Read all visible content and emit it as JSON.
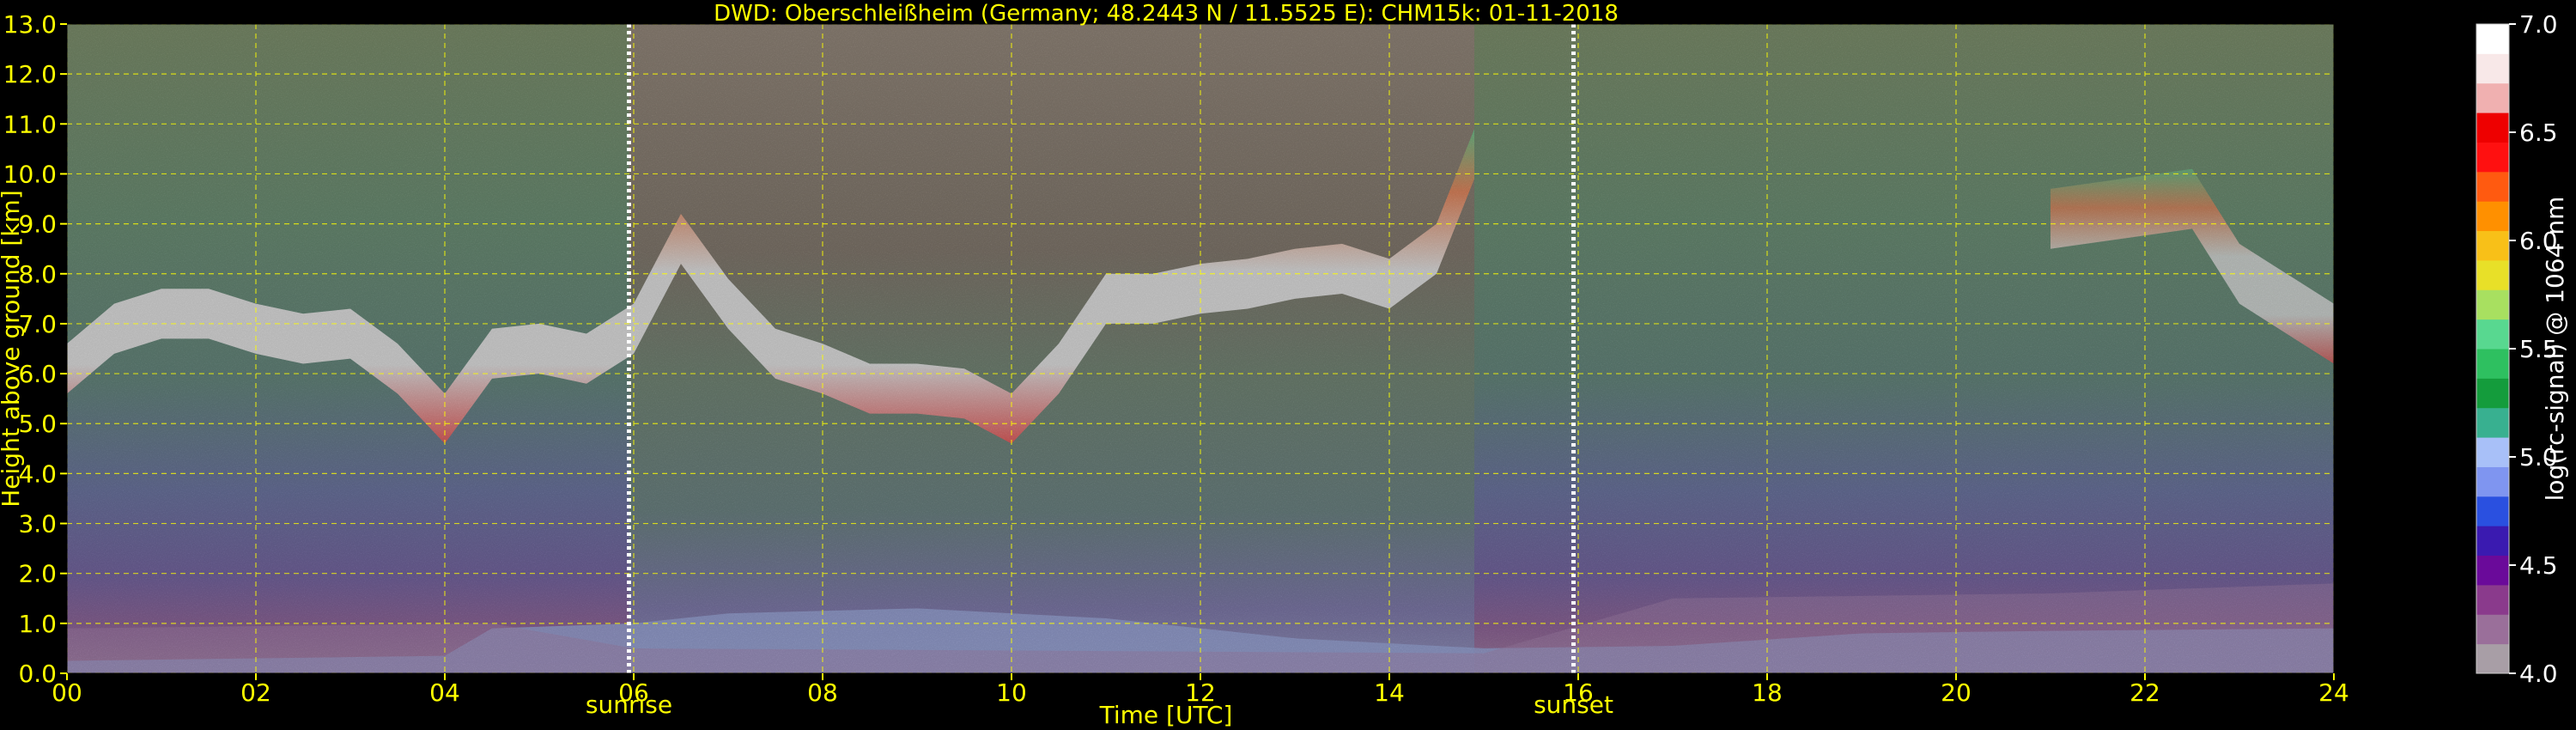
{
  "chart_data": {
    "type": "heatmap",
    "title": "DWD: Oberschleißheim (Germany; 48.2443 N / 11.5525 E):    CHM15k: 01-11-2018",
    "xlabel": "Time [UTC]",
    "ylabel": "Height above ground [km]",
    "colorbar_label": "log(rc-signal) @ 1064 nm",
    "xlim": [
      0,
      24
    ],
    "ylim": [
      0,
      13
    ],
    "x_ticks": [
      "00",
      "02",
      "04",
      "06",
      "08",
      "10",
      "12",
      "14",
      "16",
      "18",
      "20",
      "22",
      "24"
    ],
    "y_ticks": [
      "0.0",
      "1.0",
      "2.0",
      "3.0",
      "4.0",
      "5.0",
      "6.0",
      "7.0",
      "8.0",
      "9.0",
      "10.0",
      "11.0",
      "12.0",
      "13.0"
    ],
    "colorbar_range": [
      4.0,
      7.0
    ],
    "colorbar_ticks": [
      "4.0",
      "4.5",
      "5.0",
      "5.5",
      "6.0",
      "6.5",
      "7.0"
    ],
    "grid": true,
    "grid_color": "#ffff00",
    "markers": [
      {
        "label": "sunrise",
        "time": 5.95
      },
      {
        "label": "sunset",
        "time": 15.95
      }
    ],
    "colorscale": [
      "#a89ea6",
      "#9a6f9a",
      "#8a3a8c",
      "#6a0a9a",
      "#3a1ab0",
      "#2a50e0",
      "#7f95f0",
      "#a8c0f8",
      "#38b090",
      "#149c3c",
      "#2ec060",
      "#58d890",
      "#a8e060",
      "#e8e028",
      "#f8c018",
      "#ff9000",
      "#ff5a10",
      "#ff1010",
      "#ee0000",
      "#f0b0b0",
      "#f8e8e8",
      "#ffffff"
    ],
    "layers": {
      "surface_layer_km": [
        0.0,
        1.0
      ],
      "cloud_base_day_km": [
        [
          0.0,
          5.6
        ],
        [
          0.5,
          6.4
        ],
        [
          1.0,
          6.7
        ],
        [
          1.5,
          6.7
        ],
        [
          2.0,
          6.4
        ],
        [
          2.5,
          6.2
        ],
        [
          3.0,
          6.3
        ],
        [
          3.5,
          5.6
        ],
        [
          4.0,
          4.6
        ],
        [
          4.5,
          5.9
        ],
        [
          5.0,
          6.0
        ],
        [
          5.5,
          5.8
        ],
        [
          6.0,
          6.4
        ],
        [
          6.5,
          8.2
        ],
        [
          7.0,
          6.9
        ],
        [
          7.5,
          5.9
        ],
        [
          8.0,
          5.6
        ],
        [
          8.5,
          5.2
        ],
        [
          9.0,
          5.2
        ],
        [
          9.5,
          5.1
        ],
        [
          10.0,
          4.6
        ],
        [
          10.5,
          5.6
        ],
        [
          11.0,
          7.0
        ],
        [
          11.5,
          7.0
        ],
        [
          12.0,
          7.2
        ],
        [
          12.5,
          7.3
        ],
        [
          13.0,
          7.5
        ],
        [
          13.5,
          7.6
        ],
        [
          14.0,
          7.3
        ],
        [
          14.5,
          8.0
        ],
        [
          14.9,
          9.9
        ]
      ],
      "cirrus_late_km": [
        [
          21.0,
          9.1
        ],
        [
          22.5,
          9.5
        ],
        [
          23.0,
          8.0
        ],
        [
          24.0,
          6.8
        ]
      ]
    },
    "night_background": "#0f4a3a",
    "day_background": "#4a2a1a"
  }
}
